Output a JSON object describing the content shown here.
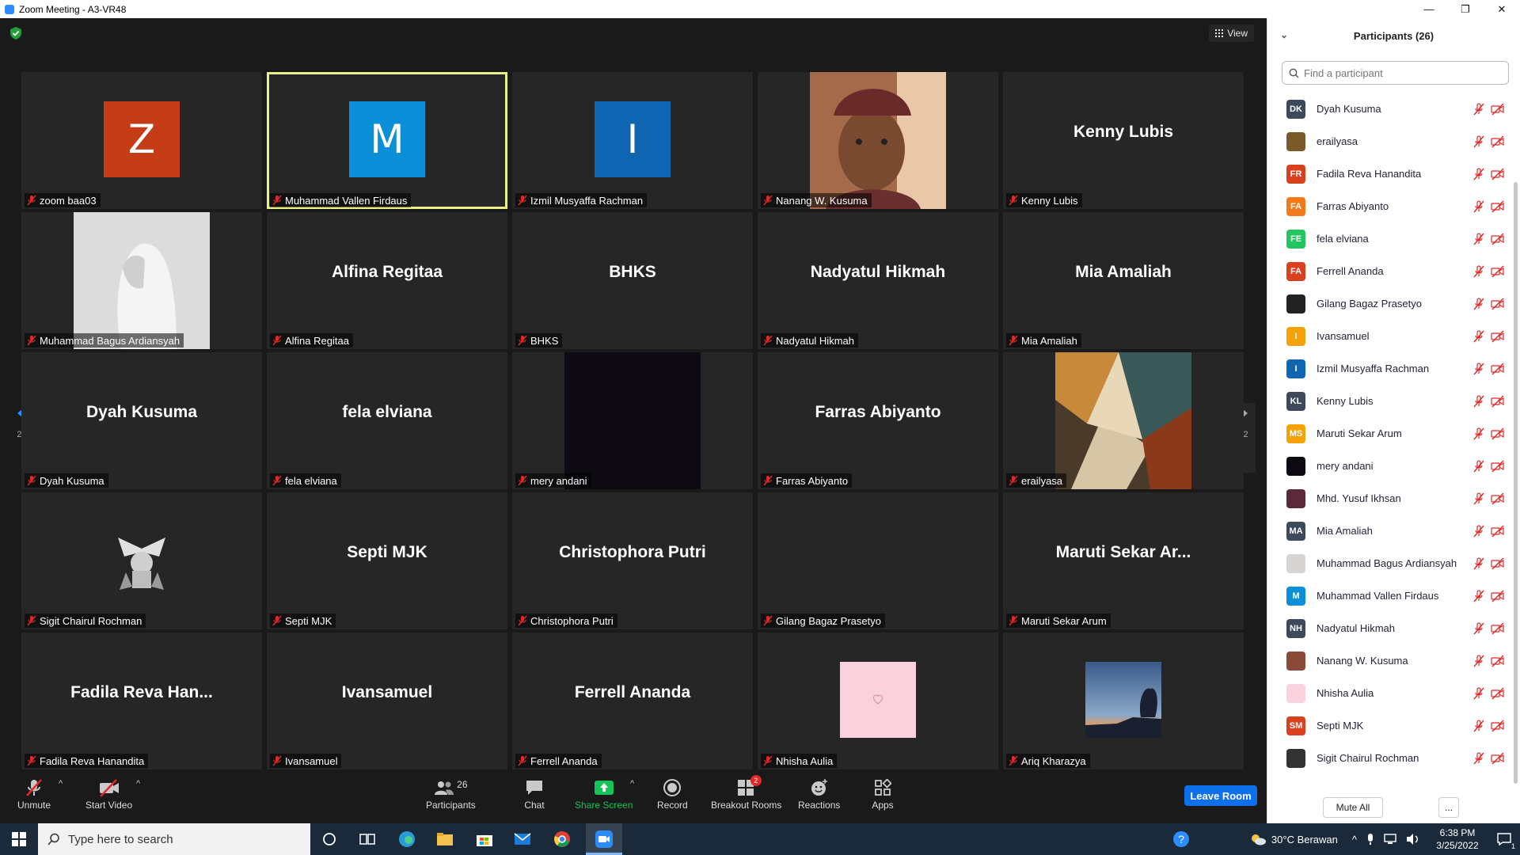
{
  "window": {
    "title": "Zoom Meeting - A3-VR48",
    "minimize": "—",
    "maximize": "❐",
    "close": "✕"
  },
  "view_button": {
    "label": "View"
  },
  "gallery": {
    "page_left": "2/2",
    "page_right": "2/2",
    "tiles": [
      {
        "kind": "avatar",
        "initial": "Z",
        "color": "#c43d16",
        "label": "zoom baa03"
      },
      {
        "kind": "avatar",
        "initial": "M",
        "color": "#0b8fd9",
        "label": "Muhammad Vallen Firdaus",
        "active": true
      },
      {
        "kind": "avatar",
        "initial": "I",
        "color": "#0f65b2",
        "label": "Izmil Musyaffa Rachman"
      },
      {
        "kind": "photo",
        "photo": "portrait-man-hat",
        "label": "Nanang W. Kusuma"
      },
      {
        "kind": "name",
        "bigname": "Kenny Lubis",
        "label": "Kenny Lubis"
      },
      {
        "kind": "photo",
        "photo": "white-hood",
        "label": "Muhammad Bagus Ardiansyah"
      },
      {
        "kind": "name",
        "bigname": "Alfina Regitaa",
        "label": "Alfina Regitaa"
      },
      {
        "kind": "name",
        "bigname": "BHKS",
        "label": "BHKS"
      },
      {
        "kind": "name",
        "bigname": "Nadyatul Hikmah",
        "label": "Nadyatul Hikmah"
      },
      {
        "kind": "name",
        "bigname": "Mia Amaliah",
        "label": "Mia Amaliah"
      },
      {
        "kind": "name",
        "bigname": "Dyah Kusuma",
        "label": "Dyah Kusuma"
      },
      {
        "kind": "name",
        "bigname": "fela elviana",
        "label": "fela elviana"
      },
      {
        "kind": "photo",
        "photo": "dark",
        "label": "mery andani"
      },
      {
        "kind": "name",
        "bigname": "Farras Abiyanto",
        "label": "Farras Abiyanto"
      },
      {
        "kind": "photo",
        "photo": "abstract",
        "label": "erailyasa"
      },
      {
        "kind": "emblem",
        "label": "Sigit Chairul Rochman"
      },
      {
        "kind": "name",
        "bigname": "Septi MJK",
        "label": "Septi MJK"
      },
      {
        "kind": "name",
        "bigname": "Christophora Putri",
        "label": "Christophora Putri"
      },
      {
        "kind": "blank",
        "label": "Gilang Bagaz Prasetyo"
      },
      {
        "kind": "name",
        "bigname": "Maruti Sekar Ar...",
        "label": "Maruti Sekar Arum"
      },
      {
        "kind": "name",
        "bigname": "Fadila Reva Han...",
        "label": "Fadila Reva Hanandita"
      },
      {
        "kind": "name",
        "bigname": "Ivansamuel",
        "label": "Ivansamuel"
      },
      {
        "kind": "name",
        "bigname": "Ferrell Ananda",
        "label": "Ferrell Ananda"
      },
      {
        "kind": "small",
        "photo": "pink-heart",
        "label": "Nhisha Aulia"
      },
      {
        "kind": "small",
        "photo": "sunset",
        "label": "Ariq Kharazya"
      }
    ]
  },
  "toolbar": {
    "unmute": "Unmute",
    "start_video": "Start Video",
    "participants": "Participants",
    "participants_count": "26",
    "chat": "Chat",
    "share_screen": "Share Screen",
    "record": "Record",
    "breakout_rooms": "Breakout Rooms",
    "breakout_badge": "2",
    "reactions": "Reactions",
    "apps": "Apps",
    "leave": "Leave Room",
    "share_color": "#16c35a",
    "leave_color": "#0e71eb"
  },
  "panel": {
    "title": "Participants (26)",
    "search_placeholder": "Find a participant",
    "mute_all": "Mute All",
    "more": "...",
    "participants": [
      {
        "initials": "DK",
        "color": "#3c4a5c",
        "name": "Dyah Kusuma"
      },
      {
        "initials": "",
        "color": "#7a5a2a",
        "name": "erailyasa",
        "photo": true
      },
      {
        "initials": "FR",
        "color": "#d9411e",
        "name": "Fadila Reva Hanandita"
      },
      {
        "initials": "FA",
        "color": "#f27a1a",
        "name": "Farras Abiyanto"
      },
      {
        "initials": "FE",
        "color": "#22c55e",
        "name": "fela elviana"
      },
      {
        "initials": "FA",
        "color": "#d9411e",
        "name": "Ferrell Ananda"
      },
      {
        "initials": "",
        "color": "#222222",
        "name": "Gilang Bagaz Prasetyo"
      },
      {
        "initials": "I",
        "color": "#f5a20a",
        "name": "Ivansamuel"
      },
      {
        "initials": "I",
        "color": "#0f65b2",
        "name": "Izmil Musyaffa Rachman"
      },
      {
        "initials": "KL",
        "color": "#3c4a5c",
        "name": "Kenny Lubis"
      },
      {
        "initials": "MS",
        "color": "#f5a20a",
        "name": "Maruti Sekar Arum"
      },
      {
        "initials": "",
        "color": "#0d0a12",
        "name": "mery andani"
      },
      {
        "initials": "",
        "color": "#5a2a3a",
        "name": "Mhd. Yusuf Ikhsan",
        "photo": true
      },
      {
        "initials": "MA",
        "color": "#3c4a5c",
        "name": "Mia Amaliah"
      },
      {
        "initials": "",
        "color": "#d8d4d4",
        "name": "Muhammad Bagus Ardiansyah",
        "photo": true
      },
      {
        "initials": "M",
        "color": "#0b8fd9",
        "name": "Muhammad Vallen Firdaus"
      },
      {
        "initials": "NH",
        "color": "#3c4a5c",
        "name": "Nadyatul Hikmah"
      },
      {
        "initials": "",
        "color": "#8a4a3a",
        "name": "Nanang W. Kusuma",
        "photo": true
      },
      {
        "initials": "",
        "color": "#f9d2de",
        "name": "Nhisha Aulia"
      },
      {
        "initials": "SM",
        "color": "#d9411e",
        "name": "Septi MJK"
      },
      {
        "initials": "",
        "color": "#333333",
        "name": "Sigit Chairul Rochman",
        "photo": true
      }
    ]
  },
  "taskbar": {
    "search_placeholder": "Type here to search",
    "weather": "30°C  Berawan",
    "time": "6:38 PM",
    "date": "3/25/2022",
    "notifications": "1"
  }
}
